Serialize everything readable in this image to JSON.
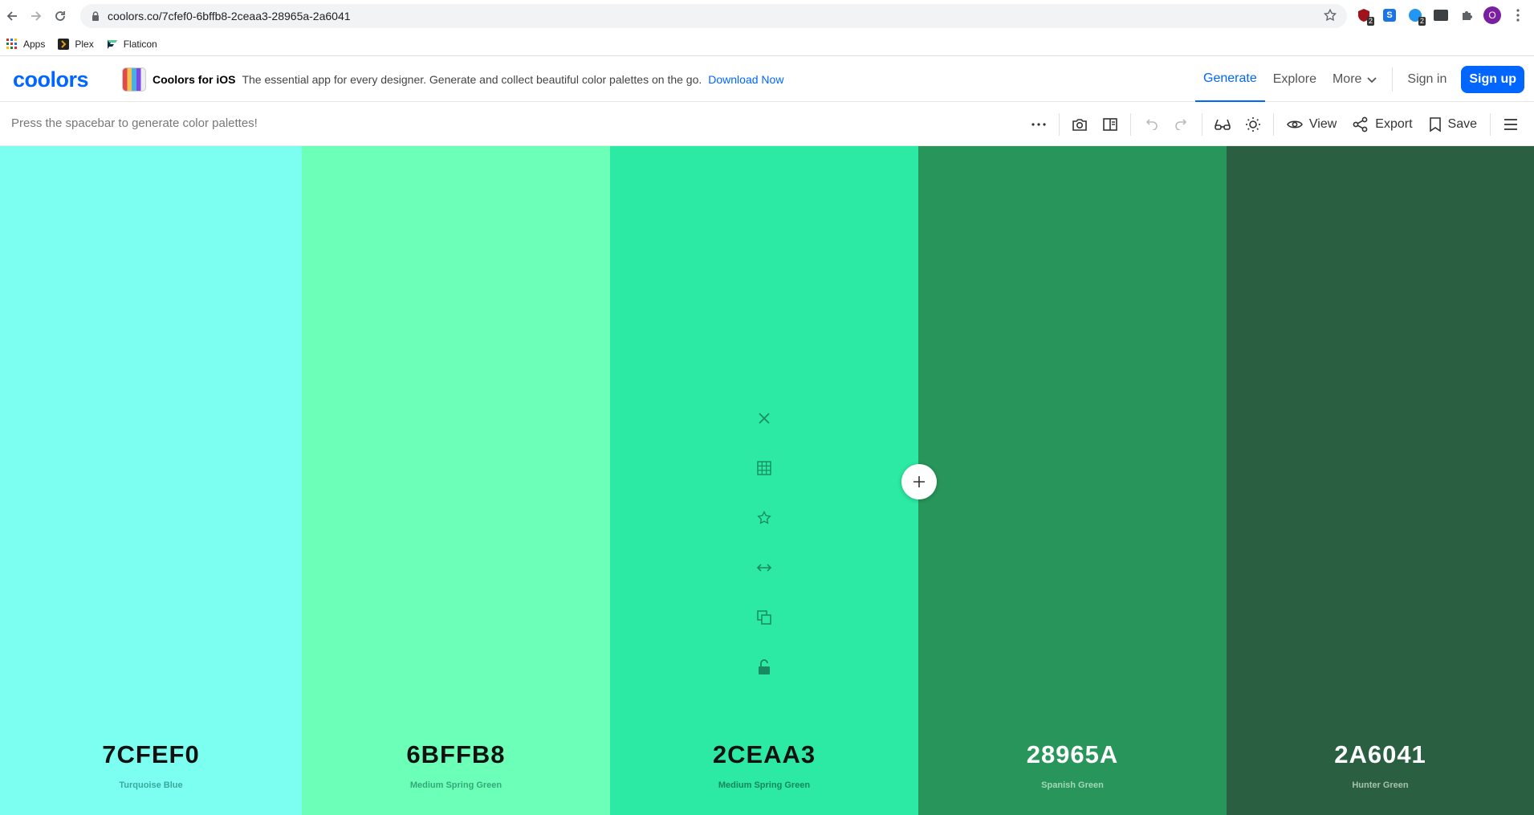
{
  "browser": {
    "url": "coolors.co/7cfef0-6bffb8-2ceaa3-28965a-2a6041",
    "avatar_letter": "O",
    "ext_badges": [
      "2",
      "2"
    ],
    "bookmarks": [
      {
        "label": "Apps",
        "icon": "apps-grid-icon"
      },
      {
        "label": "Plex",
        "icon": "plex-icon"
      },
      {
        "label": "Flaticon",
        "icon": "flaticon-icon"
      }
    ]
  },
  "header": {
    "logo": "coolors",
    "promo_title": "Coolors for iOS",
    "promo_desc": "The essential app for every designer. Generate and collect beautiful color palettes on the go.",
    "promo_link": "Download Now",
    "nav": {
      "generate": "Generate",
      "explore": "Explore",
      "more": "More",
      "signin": "Sign in",
      "signup": "Sign up"
    }
  },
  "toolbar": {
    "hint": "Press the spacebar to generate color palettes!",
    "view": "View",
    "export": "Export",
    "save": "Save"
  },
  "palette": [
    {
      "hex": "7CFEF0",
      "name": "Turquoise Blue",
      "color": "#7cfef0",
      "text_color": "#111111",
      "name_color": "#3aa89c"
    },
    {
      "hex": "6BFFB8",
      "name": "Medium Spring Green",
      "color": "#6bffb8",
      "text_color": "#111111",
      "name_color": "#36a877"
    },
    {
      "hex": "2CEAA3",
      "name": "Medium Spring Green",
      "color": "#2ceaa3",
      "text_color": "#111111",
      "name_color": "#17865c"
    },
    {
      "hex": "28965A",
      "name": "Spanish Green",
      "color": "#28965a",
      "text_color": "#ffffff",
      "name_color": "#a4d6ba"
    },
    {
      "hex": "2A6041",
      "name": "Hunter Green",
      "color": "#2a6041",
      "text_color": "#ffffff",
      "name_color": "#a6c1b0"
    }
  ],
  "colors": {
    "accent": "#0066ff"
  }
}
